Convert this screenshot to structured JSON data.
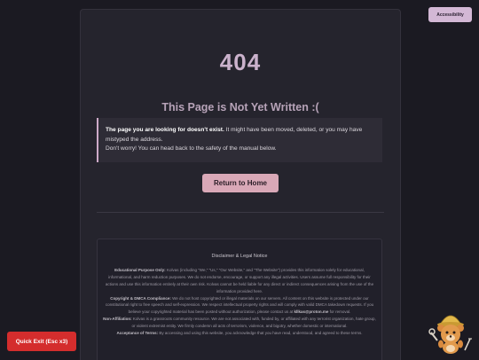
{
  "page": {
    "code": "404",
    "title": "This Page is Not Yet Written :("
  },
  "notice": {
    "bold": "The page you are looking for doesn't exist.",
    "rest": " It might have been moved, deleted, or you may have mistyped the address.",
    "line2": "Don't worry! You can head back to the safety of the manual below."
  },
  "home_button_label": "Return to Home",
  "accessibility_button_label": "Accessibility",
  "quick_exit_label": "Quick Exit (Esc x3)",
  "mascot_icon": "mascot-bear-icon",
  "disclaimer": {
    "heading": "Disclaimer & Legal Notice",
    "educational": {
      "label": "Educational Purpose Only:",
      "text": " Kolvas (including \"We,\" \"Us,\" \"Our Website,\" and \"The Website\") provides this information solely for educational, informational, and harm reduction purposes. We do not endorse, encourage, or support any illegal activities. Users assume full responsibility for their actions and use this information entirely at their own risk. Kolvas cannot be held liable for any direct or indirect consequences arising from the use of the information provided here."
    },
    "copyright": {
      "label": "Copyright & DMCA Compliance:",
      "text_before": " We do not host copyrighted or illegal materials on our servers. All content on this website is protected under our constitutional right to free speech and self-expression. We respect intellectual property rights and will comply with valid DMCA takedown requests. If you believe your copyrighted material has been posted without authorization, please contact us at ",
      "email": "kllkas@proton.me",
      "text_after": " for removal."
    },
    "affiliation": {
      "label": "Non-Affiliation:",
      "text": " Kolvas is a grassroots community resource. We are not associated with, funded by, or affiliated with any terrorist organization, hate group, or violent extremist entity. We firmly condemn all acts of terrorism, violence, and bigotry, whether domestic or international."
    },
    "terms": {
      "label": "Acceptance of Terms:",
      "text": " By accessing and using this website, you acknowledge that you have read, understood, and agreed to these terms."
    }
  },
  "colors": {
    "background": "#1b1a22",
    "panel": "#25242d",
    "accent": "#d9a8b7",
    "heading": "#cbb2cc",
    "quick_exit": "#d42d2d"
  }
}
